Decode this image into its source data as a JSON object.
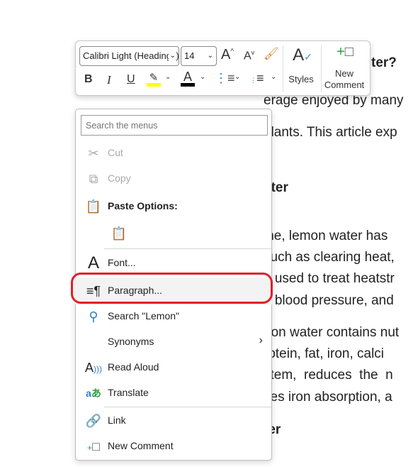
{
  "document": {
    "lines": [
      {
        "text": "ter?",
        "bold": true
      },
      {
        "text": "erage enjoyed by many",
        "bold": false
      },
      {
        "text": "idants. This article exp",
        "bold": false
      },
      {
        "text": "ater",
        "bold": true
      },
      {
        "text": "ine, lemon water has",
        "bold": false
      },
      {
        "text": "such as clearing heat,",
        "bold": false
      },
      {
        "text": "n used to treat heatstr",
        "bold": false
      },
      {
        "text": "h blood pressure, and",
        "bold": false
      },
      {
        "text": "non water contains nut",
        "bold": false
      },
      {
        "text": "rotein, fat, iron, calci",
        "bold": false
      },
      {
        "text": "stem,  reduces  the  n",
        "bold": false
      },
      {
        "text": "ves iron absorption, a",
        "bold": false
      },
      {
        "text": "ter",
        "bold": true
      }
    ]
  },
  "mini_toolbar": {
    "font_name": "Calibri Light (Headings)",
    "font_size": "14",
    "styles_label": "Styles",
    "new_comment_label_1": "New",
    "new_comment_label_2": "Comment",
    "highlight_color": "#ffff00",
    "font_color": "#000000"
  },
  "context_menu": {
    "search_placeholder": "Search the menus",
    "items": {
      "cut": "Cut",
      "copy": "Copy",
      "paste_options": "Paste Options:",
      "font": "Font...",
      "paragraph": "Paragraph...",
      "search": "Search \"Lemon\"",
      "synonyms": "Synonyms",
      "read_aloud": "Read Aloud",
      "translate": "Translate",
      "link": "Link",
      "new_comment": "New Comment"
    },
    "highlighted_item": "paragraph",
    "highlight_color": "#e0202a"
  }
}
